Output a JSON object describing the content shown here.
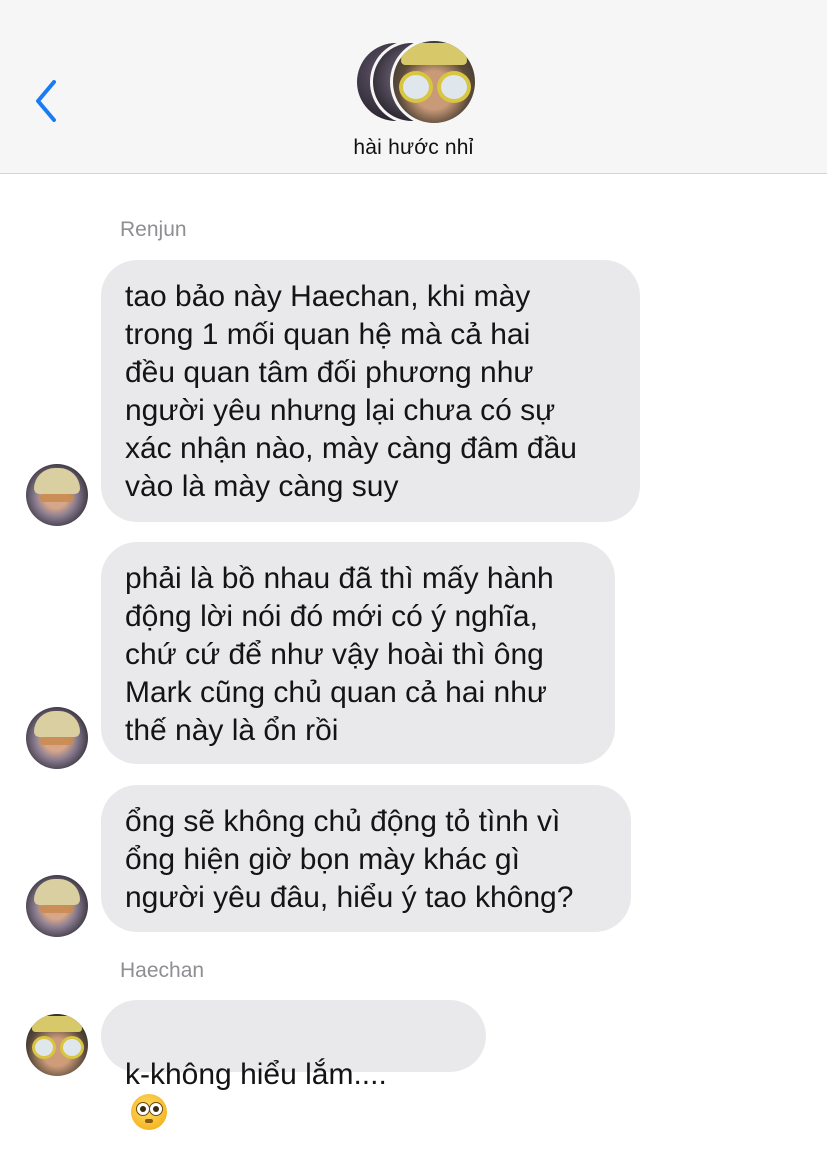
{
  "header": {
    "title": "hài hước nhỉ"
  },
  "messages": {
    "renjun_name": "Renjun",
    "haechan_name": "Haechan",
    "m1": "tao bảo này Haechan, khi mày\ntrong 1 mối quan hệ mà cả hai\nđều quan tâm đối phương như\nngười yêu nhưng lại chưa có sự\nxác nhận nào, mày càng đâm đầu\nvào là mày càng suy",
    "m2": "phải là bồ nhau đã thì mấy hành\nđộng lời nói đó mới có ý nghĩa,\nchứ cứ để như vậy hoài thì ông\nMark cũng chủ quan cả hai như\nthế này là ổn rồi",
    "m3": "ổng sẽ không chủ động tỏ tình vì\nổng hiện giờ bọn mày khác gì\nngười yêu đâu, hiểu ý tao không?",
    "m4": "k-không hiểu lắm...."
  },
  "icons": {
    "back": "chevron-left-icon",
    "reaction": "flushed-face-emoji"
  },
  "colors": {
    "accent": "#007aff",
    "bubble": "#e9e9eb",
    "header_bg": "#f6f6f6",
    "sender_text": "#8e8e93"
  }
}
